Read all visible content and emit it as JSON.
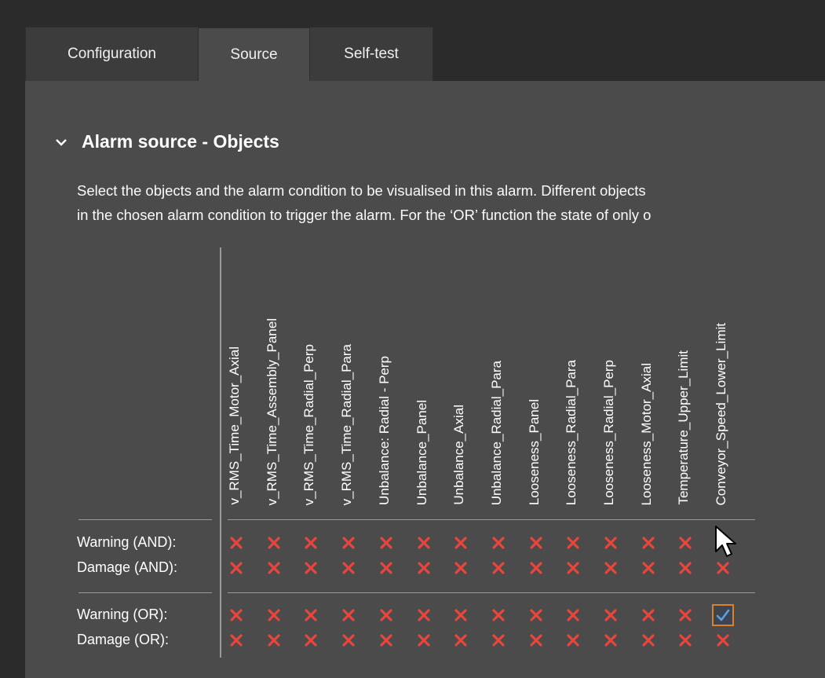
{
  "tabs": [
    {
      "label": "Configuration",
      "active": false
    },
    {
      "label": "Source",
      "active": true
    },
    {
      "label": "Self-test",
      "active": false
    }
  ],
  "section": {
    "title": "Alarm source - Objects",
    "expanded": true,
    "description_line1": "Select the objects and the alarm condition to be visualised in this alarm. Different objects",
    "description_line2": "in the chosen alarm condition to trigger the alarm. For the ‘OR’ function the state of only o"
  },
  "objects": [
    "v_RMS_Time_Motor_Axial",
    "v_RMS_Time_Assembly_Panel",
    "v_RMS_Time_Radial_Perp",
    "v_RMS_Time_Radial_Para",
    "Unbalance: Radial - Perp",
    "Unbalance_Panel",
    "Unbalance_Axial",
    "Unbalance_Radial_Para",
    "Looseness_Panel",
    "Looseness_Radial_Para",
    "Looseness_Radial_Perp",
    "Looseness_Motor_Axial",
    "Temperature_Upper_Limit",
    "Conveyor_Speed_Lower_Limit"
  ],
  "rows": [
    {
      "label": "Warning (AND):",
      "states": [
        false,
        false,
        false,
        false,
        false,
        false,
        false,
        false,
        false,
        false,
        false,
        false,
        false,
        false
      ]
    },
    {
      "label": "Damage (AND):",
      "states": [
        false,
        false,
        false,
        false,
        false,
        false,
        false,
        false,
        false,
        false,
        false,
        false,
        false,
        false
      ]
    },
    {
      "label": "Warning (OR):",
      "states": [
        false,
        false,
        false,
        false,
        false,
        false,
        false,
        false,
        false,
        false,
        false,
        false,
        false,
        true
      ]
    },
    {
      "label": "Damage (OR):",
      "states": [
        false,
        false,
        false,
        false,
        false,
        false,
        false,
        false,
        false,
        false,
        false,
        false,
        false,
        false
      ]
    }
  ],
  "colors": {
    "x_mark": "#e8453c",
    "check": "#5aa0e6",
    "focus_border": "#d9822b"
  },
  "icons": {
    "collapse": "chevron-down-icon",
    "unselected": "cross-icon",
    "selected": "checkmark-icon",
    "pointer": "mouse-pointer-icon"
  }
}
